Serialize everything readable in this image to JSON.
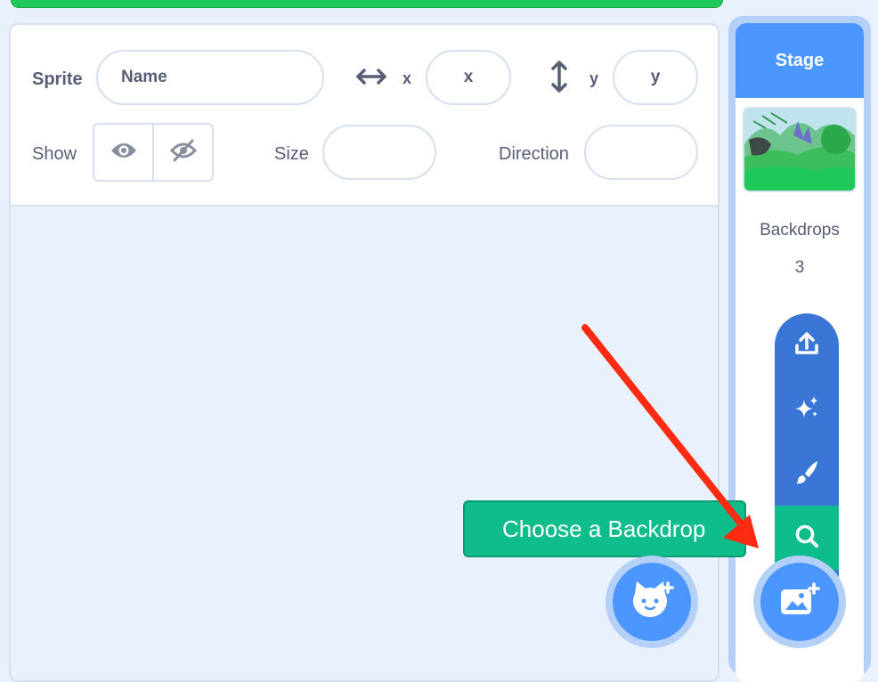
{
  "sprite_info": {
    "sprite_label": "Sprite",
    "name_placeholder": "Name",
    "x_label": "x",
    "x_placeholder": "x",
    "y_label": "y",
    "y_placeholder": "y",
    "show_label": "Show",
    "size_label": "Size",
    "direction_label": "Direction"
  },
  "stage": {
    "title": "Stage",
    "backdrops_label": "Backdrops",
    "backdrops_count": "3"
  },
  "backdrop_menu": {
    "items": [
      "upload-icon",
      "surprise-icon",
      "paint-icon",
      "search-icon"
    ],
    "active": "search-icon"
  },
  "tooltip": {
    "label": "Choose a Backdrop"
  },
  "colors": {
    "accent": "#4c97ff",
    "menu_bg": "#3a76d6",
    "active_green": "#0fbd8c",
    "annotation_arrow": "#ff2a12"
  }
}
